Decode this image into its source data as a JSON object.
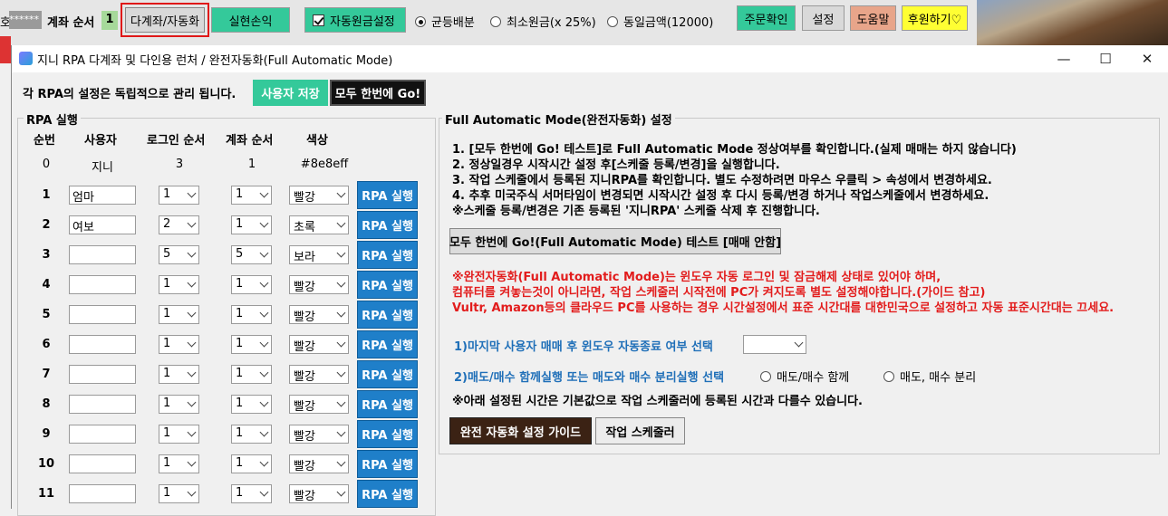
{
  "bg": {
    "left_stub": "호",
    "masked": "******",
    "account_order_label": "계좌 순서",
    "account_order_value": "1",
    "multi_account_btn": "다계좌/자동화",
    "realized_pl_btn": "실현손익",
    "auto_principal_label": "자동원금설정",
    "radio_equal": "균등배분",
    "radio_min": "최소원금(x 25%)",
    "radio_same": "동일금액(12000)",
    "order_check_btn": "주문확인",
    "settings_btn": "설정",
    "help_btn": "도움말",
    "donate_btn": "후원하기♡"
  },
  "window": {
    "title": "지니 RPA 다계좌 및 다인용 런처 / 완전자동화(Full Automatic Mode)",
    "minimize": "—",
    "maximize": "☐",
    "close": "✕"
  },
  "top": {
    "notice": "각 RPA의 설정은 독립적으로 관리 됩니다.",
    "save_btn": "사용자 저장",
    "go_all_btn": "모두 한번에 Go!"
  },
  "rpa": {
    "group_label": "RPA 실행",
    "headers": {
      "order": "순번",
      "user": "사용자",
      "login": "로그인 순서",
      "account": "계좌 순서",
      "color": "색상"
    },
    "row0": {
      "order": "0",
      "user": "지니",
      "login": "3",
      "account": "1",
      "color": "#8e8eff"
    },
    "run_label": "RPA 실행",
    "rows": [
      {
        "order": "1",
        "user": "엄마",
        "login": "1",
        "account": "1",
        "color": "빨강"
      },
      {
        "order": "2",
        "user": "여보",
        "login": "2",
        "account": "1",
        "color": "초록"
      },
      {
        "order": "3",
        "user": "",
        "login": "5",
        "account": "5",
        "color": "보라"
      },
      {
        "order": "4",
        "user": "",
        "login": "1",
        "account": "1",
        "color": "빨강"
      },
      {
        "order": "5",
        "user": "",
        "login": "1",
        "account": "1",
        "color": "빨강"
      },
      {
        "order": "6",
        "user": "",
        "login": "1",
        "account": "1",
        "color": "빨강"
      },
      {
        "order": "7",
        "user": "",
        "login": "1",
        "account": "1",
        "color": "빨강"
      },
      {
        "order": "8",
        "user": "",
        "login": "1",
        "account": "1",
        "color": "빨강"
      },
      {
        "order": "9",
        "user": "",
        "login": "1",
        "account": "1",
        "color": "빨강"
      },
      {
        "order": "10",
        "user": "",
        "login": "1",
        "account": "1",
        "color": "빨강"
      },
      {
        "order": "11",
        "user": "",
        "login": "1",
        "account": "1",
        "color": "빨강"
      }
    ]
  },
  "fam": {
    "group_label": "Full Automatic Mode(완전자동화) 설정",
    "step1": "1. [모두 한번에 Go! 테스트]로 Full Automatic Mode 정상여부를 확인합니다.(실제 매매는 하지 않습니다)",
    "step2": "2. 정상일경우 시작시간 설정 후[스케줄 등록/변경]을 실행합니다.",
    "step3": "3. 작업 스케줄에서 등록된 지니RPA를 확인합니다. 별도 수정하려면 마우스 우클릭 > 속성에서 변경하세요.",
    "step4": "4. 추후 미국주식 서머타임이 변경되면 시작시간 설정 후 다시 등록/변경 하거나 작업스케줄에서 변경하세요.",
    "step_note": "※스케줄 등록/변경은 기존 등록된 '지니RPA' 스케줄 삭제 후 진행합니다.",
    "test_btn": "모두 한번에 Go!(Full Automatic Mode) 테스트 [매매 안함]",
    "warn1": "※완전자동화(Full Automatic Mode)는 윈도우 자동 로그인 및 잠금해제 상태로 있어야 하며,",
    "warn2": "컴퓨터를 켜놓는것이 아니라면, 작업 스케줄러 시작전에 PC가 켜지도록 별도 설정해야합니다.(가이드 참고)",
    "warn3": "Vultr, Amazon등의 클라우드 PC를 사용하는 경우 시간설정에서 표준 시간대를 대한민국으로 설정하고 자동 표준시간대는 끄세요.",
    "opt1": "1)마지막 사용자 매매 후 윈도우 자동종료 여부 선택",
    "opt1_value": "",
    "opt2": "2)매도/매수 함께실행 또는 매도와 매수 분리실행 선택",
    "opt2_a": "매도/매수 함께",
    "opt2_b": "매도, 매수 분리",
    "time_note": "※아래 설정된 시간은 기본값으로 작업 스케줄러에 등록된 시간과 다를수 있습니다.",
    "guide_btn": "완전 자동화 설정 가이드",
    "scheduler_btn": "작업 스케줄러"
  }
}
